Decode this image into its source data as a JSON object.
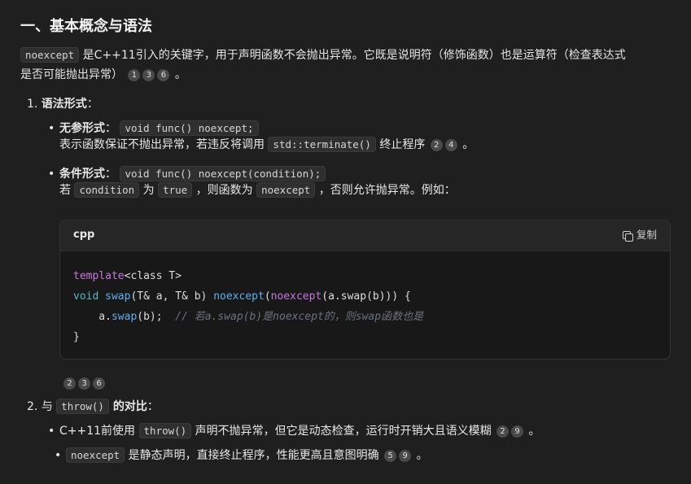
{
  "heading": "一、基本概念与语法",
  "intro": {
    "code": "noexcept",
    "text1": " 是C++11引入的关键字，用于声明函数不会抛出异常。它既是说明符（修饰函数）也是运算符（检查表达式",
    "text2": "是否可能抛出异常）",
    "cites": [
      "1",
      "3",
      "6"
    ],
    "end": " 。"
  },
  "item1": {
    "num": "1.",
    "title": "语法形式",
    "colon": "：",
    "b1": {
      "label": "无参形式",
      "colon": "：",
      "code": "void func() noexcept;",
      "desc_a": "表示函数保证不抛出异常，若违反将调用 ",
      "desc_code": "std::terminate()",
      "desc_b": " 终止程序",
      "cites": [
        "2",
        "4"
      ],
      "end": " 。"
    },
    "b2": {
      "label": "条件形式",
      "colon": "：",
      "code": "void func() noexcept(condition);",
      "d1": "若 ",
      "c1": "condition",
      "d2": " 为 ",
      "c2": "true",
      "d3": " ，则函数为 ",
      "c3": "noexcept",
      "d4": " ，否则允许抛异常。例如："
    }
  },
  "codeblock": {
    "lang": "cpp",
    "copy_label": "复制",
    "lines": {
      "l1_kw": "template",
      "l1_rest": "<class T>",
      "l2_kw": "void",
      "l2_fn": "swap",
      "l2_mid": "(T& a, T& b) ",
      "l2_ne": "noexcept",
      "l2_p": "(",
      "l2_ne2": "noexcept",
      "l2_end": "(a.swap(b))) {",
      "l3_a": "    a.",
      "l3_fn": "swap",
      "l3_b": "(b);  ",
      "l3_cm": "// 若a.swap(b)是noexcept的，则swap函数也是",
      "l4": "}"
    }
  },
  "after_code_cites": [
    "2",
    "3",
    "6"
  ],
  "item2": {
    "num": "2.",
    "pre": "与 ",
    "code": "throw()",
    "title": " 的对比",
    "colon": "：",
    "b1": {
      "a": "C++11前使用 ",
      "code": "throw()",
      "b": " 声明不抛异常，但它是动态检查，运行时开销大且语义模糊",
      "cites": [
        "2",
        "9"
      ],
      "end": " 。"
    },
    "b2": {
      "code": "noexcept",
      "b": " 是静态声明，直接终止程序，性能更高且意图明确",
      "cites": [
        "5",
        "9"
      ],
      "end": " 。"
    }
  }
}
